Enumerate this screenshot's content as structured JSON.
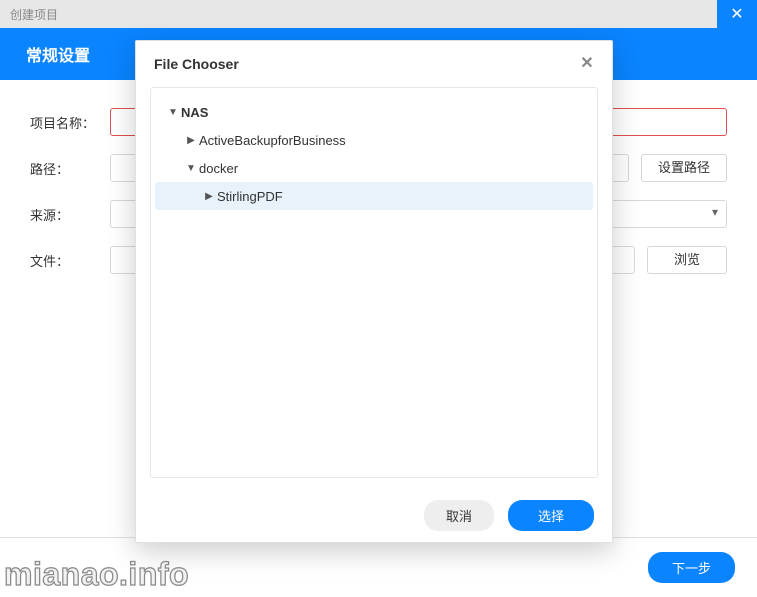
{
  "window": {
    "title": "创建项目",
    "header": "常规设置",
    "labels": {
      "project_name": "项目名称：",
      "path": "路径：",
      "source": "来源：",
      "file": "文件："
    },
    "buttons": {
      "set_path": "设置路径",
      "browse": "浏览",
      "next": "下一步"
    }
  },
  "modal": {
    "title": "File Chooser",
    "tree": [
      {
        "label": "NAS",
        "level": 0,
        "expanded": true,
        "bold": true,
        "selected": false
      },
      {
        "label": "ActiveBackupforBusiness",
        "level": 1,
        "expanded": false,
        "bold": false,
        "selected": false
      },
      {
        "label": "docker",
        "level": 1,
        "expanded": true,
        "bold": false,
        "selected": false
      },
      {
        "label": "StirlingPDF",
        "level": 2,
        "expanded": false,
        "bold": false,
        "selected": true
      }
    ],
    "buttons": {
      "cancel": "取消",
      "select": "选择"
    }
  },
  "watermark": "mianao.info"
}
